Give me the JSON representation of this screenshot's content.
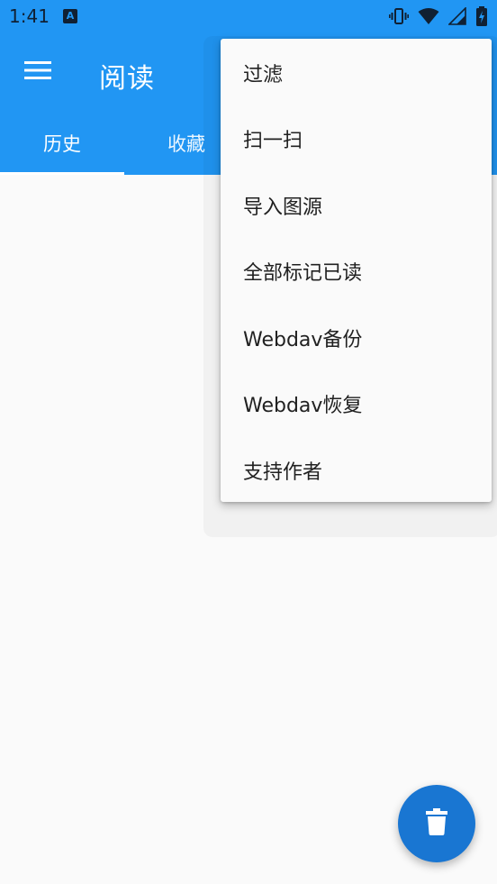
{
  "status_bar": {
    "time": "1:41",
    "notification_icon": "A",
    "icons": [
      "vibrate-icon",
      "wifi-icon",
      "signal-icon",
      "battery-charging-icon"
    ]
  },
  "app_bar": {
    "title": "阅读",
    "menu_icon": "hamburger-icon"
  },
  "tabs": [
    {
      "label": "历史",
      "selected": true
    },
    {
      "label": "收藏",
      "selected": false
    }
  ],
  "overflow_menu": {
    "items": [
      {
        "label": "过滤"
      },
      {
        "label": "扫一扫"
      },
      {
        "label": "导入图源"
      },
      {
        "label": "全部标记已读"
      },
      {
        "label": "Webdav备份"
      },
      {
        "label": "Webdav恢复"
      },
      {
        "label": "支持作者"
      }
    ]
  },
  "fab": {
    "icon": "delete-icon"
  },
  "colors": {
    "primary": "#2196f3",
    "fab": "#1976d2",
    "background": "#fafafa",
    "menu_text": "#212121"
  }
}
